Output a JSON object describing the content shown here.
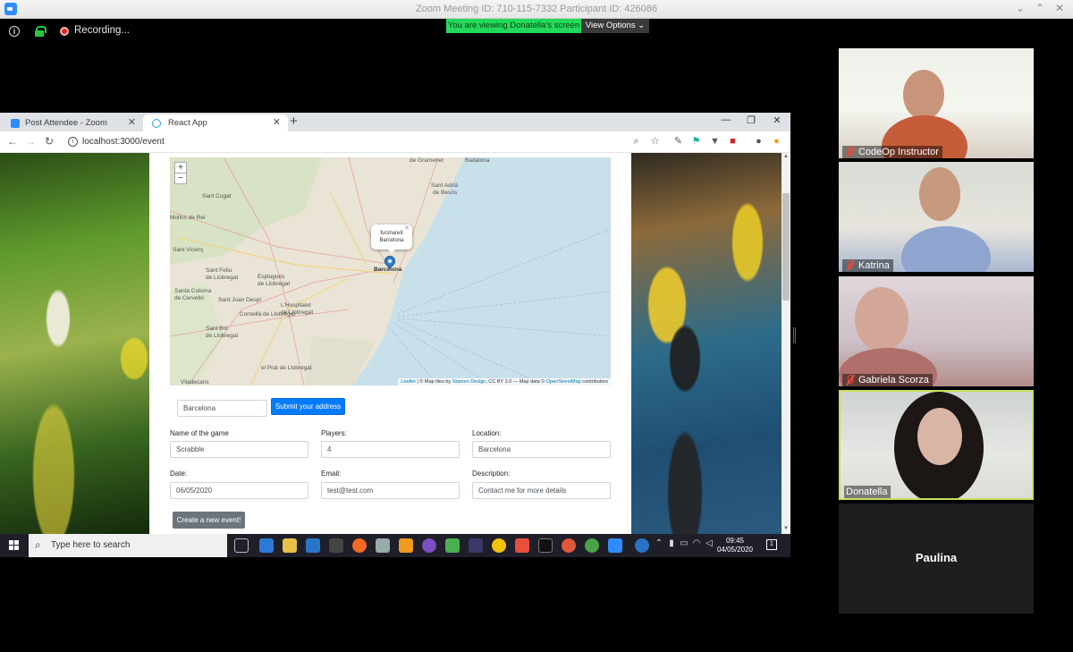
{
  "zoom": {
    "title": "Zoom Meeting ID: 710-115-7332 Participant ID: 426086",
    "recording_label": "Recording...",
    "viewing_banner": "You are viewing Donatella's screen",
    "view_options_label": "View Options ⌄"
  },
  "browser": {
    "tabs": [
      {
        "label": "Post Attendee - Zoom"
      },
      {
        "label": "React App"
      }
    ],
    "url": "localhost:3000/event"
  },
  "map": {
    "popup_line1": "furshare8",
    "popup_line2": "Barcelona",
    "labels": {
      "gramenet": "de Gramenet",
      "badalona": "Badalona",
      "adria": "Sant Adrià",
      "besos": "de Besòs",
      "barcelona": "Barcelona",
      "feliu": "Sant Feliu",
      "feliu2": "de Llobregat",
      "esplugues": "Esplugues",
      "esplugues2": "de Llobregat",
      "despi": "Sant Joan Despí",
      "hospitalet": "L'Hospitalet",
      "hospitalet2": "de Llobregat",
      "cornella": "Cornellà de Llobregat",
      "boi": "Sant Boi",
      "boi2": "de Llobregat",
      "prat": "el Prat de Llobregat",
      "viladecans": "Viladecans",
      "coloma": "Santa Coloma",
      "coloma2": "de Cervelló",
      "reis": "Molins de Rei",
      "vicenc": "Sant Vicenç",
      "cugat": "Sant Cugat"
    },
    "attribution_leaflet": "Leaflet",
    "attribution_mid": " | © Map tiles by ",
    "attribution_stamen": "Stamen Design",
    "attribution_cc": ", CC BY 3.0 — Map data © ",
    "attribution_osm": "OpenStreetMap",
    "attribution_end": " contributors"
  },
  "form": {
    "address_value": "Barcelona",
    "submit_label": "Submit your address",
    "name_label": "Name of the game",
    "name_value": "Scrabble",
    "players_label": "Players:",
    "players_value": "4",
    "location_label": "Location:",
    "location_value": "Barcelona",
    "date_label": "Date:",
    "date_value": "06/05/2020",
    "email_label": "Email:",
    "email_value": "test@test.com",
    "description_label": "Description:",
    "description_value": "Contact me for more details",
    "create_label": "Create a new event!"
  },
  "taskbar": {
    "search_placeholder": "Type here to search",
    "time": "09:45",
    "date": "04/05/2020"
  },
  "participants": [
    {
      "name": "CodeOp Instructor"
    },
    {
      "name": "Katrina"
    },
    {
      "name": "Gabriela Scorza"
    },
    {
      "name": "Donatella"
    },
    {
      "name": "Paulina"
    }
  ]
}
